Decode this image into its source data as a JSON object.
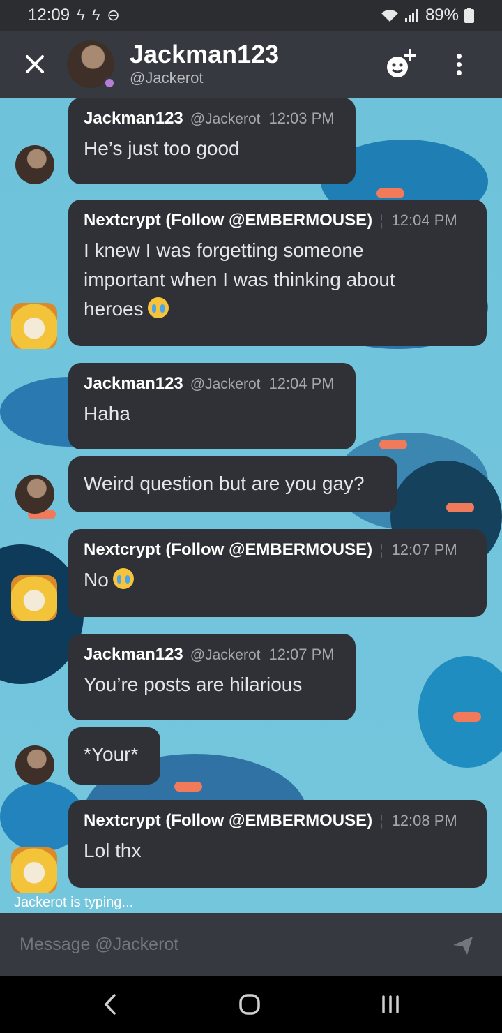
{
  "status_bar": {
    "time": "12:09",
    "battery": "89%",
    "icons": [
      "flash-icon",
      "flash-icon",
      "do-not-disturb-icon",
      "wifi-icon",
      "signal-icon",
      "battery-icon"
    ]
  },
  "header": {
    "name": "Jackman123",
    "handle": "@Jackerot",
    "status_color": "#b77ed6"
  },
  "messages": [
    {
      "author": "Jackman123",
      "handle": "@Jackerot",
      "time": "12:03 PM",
      "lines": [
        "He’s just too good"
      ],
      "emoji": false
    },
    {
      "author": "Nextcrypt (Follow @EMBERMOUSE)",
      "handle": "",
      "time": "12:04 PM",
      "lines": [
        "I knew I was forgetting someone",
        "important when I was thinking about",
        "heroes"
      ],
      "emoji": true
    },
    {
      "author": "Jackman123",
      "handle": "@Jackerot",
      "time": "12:04 PM",
      "lines": [
        "Haha"
      ],
      "emoji": false
    },
    {
      "author": "",
      "handle": "",
      "time": "",
      "lines": [
        "Weird question but are you gay?"
      ],
      "emoji": false
    },
    {
      "author": "Nextcrypt (Follow @EMBERMOUSE)",
      "handle": "",
      "time": "12:07 PM",
      "lines": [
        "No"
      ],
      "emoji": true
    },
    {
      "author": "Jackman123",
      "handle": "@Jackerot",
      "time": "12:07 PM",
      "lines": [
        "You’re posts are hilarious"
      ],
      "emoji": false
    },
    {
      "author": "",
      "handle": "",
      "time": "",
      "lines": [
        "*Your*"
      ],
      "emoji": false
    },
    {
      "author": "Nextcrypt (Follow @EMBERMOUSE)",
      "handle": "",
      "time": "12:08 PM",
      "lines": [
        "Lol thx"
      ],
      "emoji": false
    }
  ],
  "typing_indicator": "Jackerot is typing...",
  "composer": {
    "placeholder": "Message @Jackerot"
  },
  "colors": {
    "chat_background": "#6ec3db",
    "bubble": "#2f3136",
    "header": "#36393f"
  }
}
